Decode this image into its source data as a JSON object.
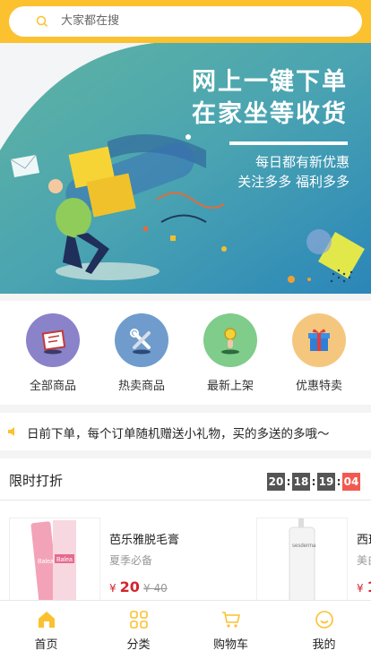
{
  "search": {
    "placeholder": "大家都在搜"
  },
  "banner": {
    "headline_1": "网上一键下单",
    "headline_2": "在家坐等收货",
    "sub_1": "每日都有新优惠",
    "sub_2": "关注多多  福利多多"
  },
  "categories": [
    {
      "label": "全部商品",
      "icon": "clipboard-icon",
      "color": "#8a83c9"
    },
    {
      "label": "热卖商品",
      "icon": "wrench-icon",
      "color": "#6f9ccd"
    },
    {
      "label": "最新上架",
      "icon": "coin-hand-icon",
      "color": "#7fcc8b"
    },
    {
      "label": "优惠特卖",
      "icon": "gift-icon",
      "color": "#f5c77e"
    }
  ],
  "notice": {
    "text": "日前下单，每个订单随机赠送小礼物，买的多送的多哦～"
  },
  "flash_sale": {
    "title": "限时打折",
    "countdown": [
      "20",
      "18",
      "19",
      "04"
    ],
    "products": [
      {
        "name": "芭乐雅脱毛膏",
        "subtitle": "夏季必备",
        "currency": "¥",
        "price": "20",
        "old_price": "¥ 40",
        "brand": "Balea"
      },
      {
        "name": "西班",
        "subtitle": "美白",
        "currency": "¥",
        "price": "1",
        "brand": "sesderma"
      }
    ]
  },
  "tabbar": {
    "items": [
      {
        "label": "首页",
        "icon": "home-icon",
        "active": true
      },
      {
        "label": "分类",
        "icon": "grid-icon",
        "active": false
      },
      {
        "label": "购物车",
        "icon": "cart-icon",
        "active": false
      },
      {
        "label": "我的",
        "icon": "smile-icon",
        "active": false
      }
    ]
  },
  "colors": {
    "accent": "#fcc12f",
    "price": "#d2252c",
    "countdown_red": "#f25a4f"
  }
}
